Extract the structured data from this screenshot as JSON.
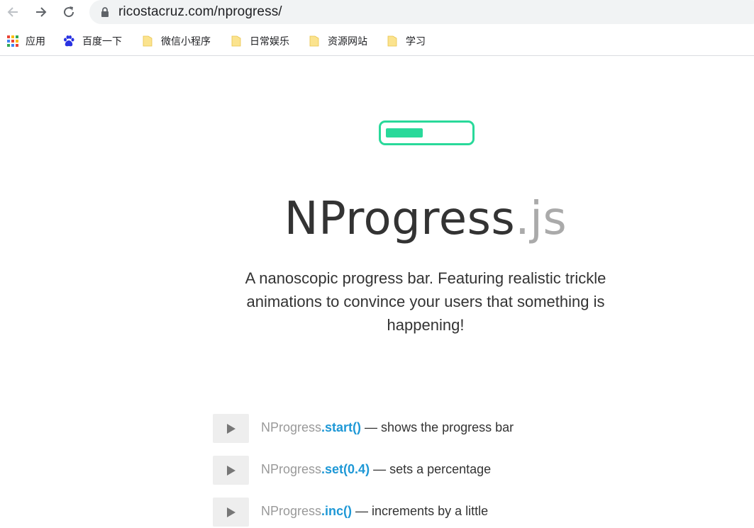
{
  "browser": {
    "url": "ricostacruz.com/nprogress/",
    "bookmarks": [
      {
        "label": "应用",
        "icon": "apps-grid-icon"
      },
      {
        "label": "百度一下",
        "icon": "baidu-paw-icon"
      },
      {
        "label": "微信小程序",
        "icon": "folder-icon"
      },
      {
        "label": "日常娱乐",
        "icon": "folder-icon"
      },
      {
        "label": "资源网站",
        "icon": "folder-icon"
      },
      {
        "label": "学习",
        "icon": "folder-icon"
      }
    ]
  },
  "page": {
    "demo_progress": 0.45,
    "accent_color": "#29d99a",
    "brand_name": "NProgress",
    "brand_ext": ".js",
    "tagline": "A nanoscopic progress bar. Featuring realistic trickle animations to convince your users that something is happening!",
    "examples": [
      {
        "object": "NProgress",
        "method": ".start()",
        "desc": " — shows the progress bar"
      },
      {
        "object": "NProgress",
        "method": ".set(0.4)",
        "desc": " — sets a percentage"
      },
      {
        "object": "NProgress",
        "method": ".inc()",
        "desc": " — increments by a little"
      }
    ]
  }
}
